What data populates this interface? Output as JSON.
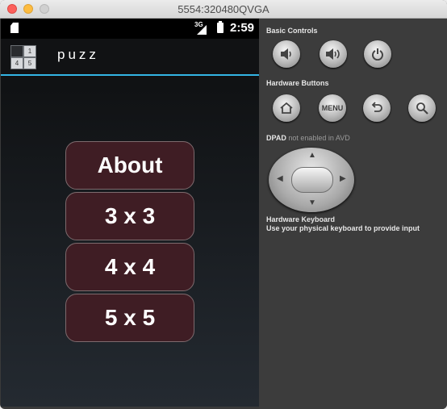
{
  "window": {
    "title": "5554:320480QVGA"
  },
  "statusbar": {
    "network": "3G",
    "time": "2:59"
  },
  "app": {
    "title": "puzz",
    "icon_tiles": [
      "",
      "1",
      "4",
      "5"
    ]
  },
  "menu": {
    "about": "About",
    "three": "3 x 3",
    "four": "4 x 4",
    "five": "5 x 5"
  },
  "controls": {
    "basic_title": "Basic Controls",
    "hardware_title": "Hardware Buttons",
    "menu_label": "MENU",
    "dpad_title": "DPAD",
    "dpad_note": "not enabled in AVD",
    "keyboard_title": "Hardware Keyboard",
    "keyboard_note": "Use your physical keyboard to provide input"
  },
  "icons": {
    "volume_down": "volume-down-icon",
    "volume_up": "volume-up-icon",
    "power": "power-icon",
    "home": "home-icon",
    "back": "back-icon",
    "search": "search-icon"
  }
}
